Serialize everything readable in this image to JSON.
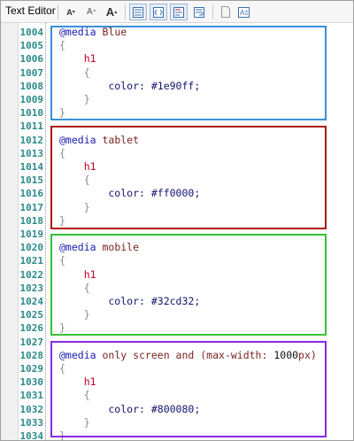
{
  "toolbar": {
    "title": "Text Editor",
    "buttons": [
      {
        "name": "decrease-font-size-button",
        "label": "A",
        "sup": "▾"
      },
      {
        "name": "reset-font-size-button",
        "label": "A",
        "sup": "ᐞ"
      },
      {
        "name": "increase-font-size-button",
        "label": "A",
        "sup": "▴"
      }
    ],
    "icons": [
      {
        "name": "line-numbers-icon"
      },
      {
        "name": "code-view-icon"
      },
      {
        "name": "outline-icon"
      },
      {
        "name": "word-wrap-icon"
      },
      {
        "name": "page-icon"
      },
      {
        "name": "font-settings-icon"
      }
    ],
    "box_colors": {
      "blue": "#3a8fd8",
      "red": "#b01818",
      "green": "#35c135",
      "purple": "#8a2be2"
    }
  },
  "editor": {
    "lines": [
      {
        "n": "1004",
        "c": [
          {
            "t": "@media ",
            "k": "kw"
          },
          {
            "t": "Blue",
            "k": "arg"
          }
        ]
      },
      {
        "n": "1005",
        "c": [
          {
            "t": "{",
            "k": "brace"
          }
        ]
      },
      {
        "n": "1006",
        "c": [
          {
            "t": "    h1",
            "k": "sel"
          }
        ]
      },
      {
        "n": "1007",
        "c": [
          {
            "t": "    {",
            "k": "brace"
          }
        ]
      },
      {
        "n": "1008",
        "c": [
          {
            "t": "        color",
            "k": "prop"
          },
          {
            "t": ": #1e90ff;",
            "k": "val"
          }
        ]
      },
      {
        "n": "1009",
        "c": [
          {
            "t": "    }",
            "k": "brace"
          }
        ]
      },
      {
        "n": "1010",
        "c": [
          {
            "t": "}",
            "k": "brace"
          }
        ]
      },
      {
        "n": "1011",
        "c": []
      },
      {
        "n": "1012",
        "c": [
          {
            "t": "@media ",
            "k": "kw"
          },
          {
            "t": "tablet",
            "k": "arg"
          }
        ]
      },
      {
        "n": "1013",
        "c": [
          {
            "t": "{",
            "k": "brace"
          }
        ]
      },
      {
        "n": "1014",
        "c": [
          {
            "t": "    h1",
            "k": "sel"
          }
        ]
      },
      {
        "n": "1015",
        "c": [
          {
            "t": "    {",
            "k": "brace"
          }
        ]
      },
      {
        "n": "1016",
        "c": [
          {
            "t": "        color",
            "k": "prop"
          },
          {
            "t": ": #ff0000;",
            "k": "val"
          }
        ]
      },
      {
        "n": "1017",
        "c": [
          {
            "t": "    }",
            "k": "brace"
          }
        ]
      },
      {
        "n": "1018",
        "c": [
          {
            "t": "}",
            "k": "brace"
          }
        ]
      },
      {
        "n": "1019",
        "c": []
      },
      {
        "n": "1020",
        "c": [
          {
            "t": "@media ",
            "k": "kw"
          },
          {
            "t": "mobile",
            "k": "arg"
          }
        ]
      },
      {
        "n": "1021",
        "c": [
          {
            "t": "{",
            "k": "brace"
          }
        ]
      },
      {
        "n": "1022",
        "c": [
          {
            "t": "    h1",
            "k": "sel"
          }
        ]
      },
      {
        "n": "1023",
        "c": [
          {
            "t": "    {",
            "k": "brace"
          }
        ]
      },
      {
        "n": "1024",
        "c": [
          {
            "t": "        color",
            "k": "prop"
          },
          {
            "t": ": #32cd32;",
            "k": "val"
          }
        ]
      },
      {
        "n": "1025",
        "c": [
          {
            "t": "    }",
            "k": "brace"
          }
        ]
      },
      {
        "n": "1026",
        "c": [
          {
            "t": "}",
            "k": "brace"
          }
        ]
      },
      {
        "n": "1027",
        "c": []
      },
      {
        "n": "1028",
        "c": [
          {
            "t": "@media ",
            "k": "kw"
          },
          {
            "t": "only screen and ",
            "k": "arg"
          },
          {
            "t": "(max-width: ",
            "k": "arg"
          },
          {
            "t": "1000",
            "k": "num"
          },
          {
            "t": "px)",
            "k": "arg"
          }
        ]
      },
      {
        "n": "1029",
        "c": [
          {
            "t": "{",
            "k": "brace"
          }
        ]
      },
      {
        "n": "1030",
        "c": [
          {
            "t": "    h1",
            "k": "sel"
          }
        ]
      },
      {
        "n": "1031",
        "c": [
          {
            "t": "    {",
            "k": "brace"
          }
        ]
      },
      {
        "n": "1032",
        "c": [
          {
            "t": "        color",
            "k": "prop"
          },
          {
            "t": ": #800080;",
            "k": "val"
          }
        ]
      },
      {
        "n": "1033",
        "c": [
          {
            "t": "    }",
            "k": "brace"
          }
        ]
      },
      {
        "n": "1034",
        "c": [
          {
            "t": "}",
            "k": "brace"
          }
        ]
      }
    ]
  }
}
